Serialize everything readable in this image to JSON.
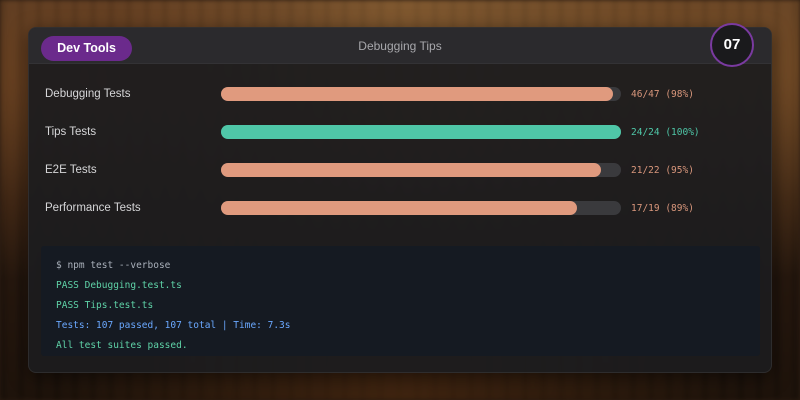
{
  "header": {
    "pill_label": "Dev Tools",
    "title": "Debugging Tips",
    "badge_number": "07"
  },
  "colors": {
    "pill": "#6b2a8c",
    "badge_ring": "#7a3aa0",
    "bar_salmon": "#e09a7e",
    "bar_teal": "#4fc7a8",
    "stat_salmon": "#d9977c",
    "stat_teal": "#4fc7a8",
    "term_gray": "#a9b0ba",
    "term_green": "#5fd3a8",
    "term_blue": "#6aa8ff"
  },
  "tests": [
    {
      "label": "Debugging Tests",
      "passed": 46,
      "total": 47,
      "stat": "46/47 (98%)",
      "fraction": 0.98,
      "color": "#e09a7e",
      "stat_color": "#d9977c"
    },
    {
      "label": "Tips Tests",
      "passed": 24,
      "total": 24,
      "stat": "24/24 (100%)",
      "fraction": 1.0,
      "color": "#4fc7a8",
      "stat_color": "#4fc7a8"
    },
    {
      "label": "E2E Tests",
      "passed": 21,
      "total": 22,
      "stat": "21/22 (95%)",
      "fraction": 0.95,
      "color": "#e09a7e",
      "stat_color": "#d9977c"
    },
    {
      "label": "Performance Tests",
      "passed": 17,
      "total": 19,
      "stat": "17/19 (89%)",
      "fraction": 0.89,
      "color": "#e09a7e",
      "stat_color": "#d9977c"
    }
  ],
  "terminal": {
    "lines": [
      {
        "text": "$ npm test --verbose",
        "color": "#a9b0ba"
      },
      {
        "text": "PASS Debugging.test.ts",
        "color": "#5fd3a8"
      },
      {
        "text": "PASS Tips.test.ts",
        "color": "#5fd3a8"
      },
      {
        "text": "Tests: 107 passed, 107 total | Time: 7.3s",
        "color": "#6aa8ff"
      },
      {
        "text": "All test suites passed.",
        "color": "#5fd3a8"
      }
    ]
  }
}
